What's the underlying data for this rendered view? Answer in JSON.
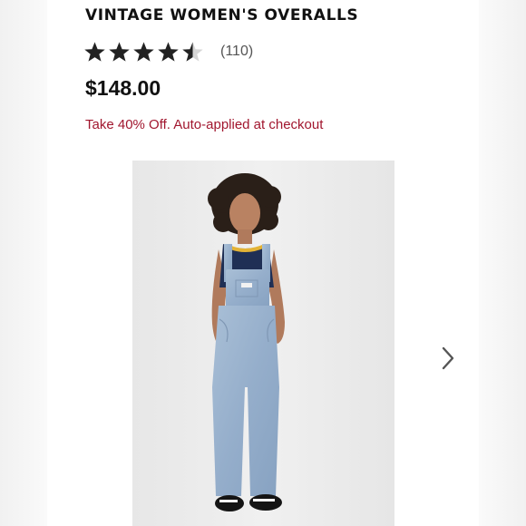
{
  "product": {
    "title": "VINTAGE WOMEN'S OVERALLS",
    "rating": 4.5,
    "rating_max": 5,
    "review_count": "(110)",
    "price": "$148.00",
    "promo": "Take 40% Off. Auto-applied at checkout"
  },
  "colors": {
    "promo": "#a1162e",
    "star": "#222222",
    "star_empty": "#d6d6d6",
    "image_bg": "#ececec"
  },
  "icons": {
    "rating_star": "star-icon",
    "next": "chevron-right-icon"
  }
}
